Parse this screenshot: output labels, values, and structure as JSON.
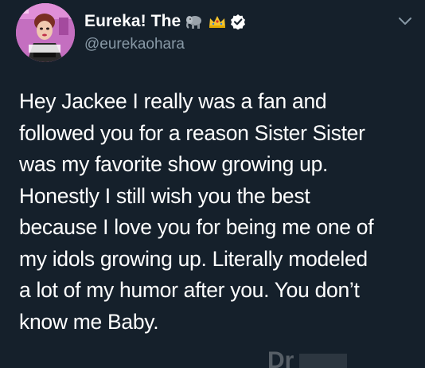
{
  "tweet": {
    "display_name": "Eureka! The",
    "handle": "@eurekaohara",
    "badges": [
      "elephant-icon",
      "crown-icon",
      "verified-badge-icon"
    ],
    "text": "Hey Jackee I really was a fan and\nfollowed  you for a reason Sister Sister\nwas my favorite show growing up.\nHonestly I still wish you the best\nbecause I love you for being me one of\nmy idols growing up. Literally modeled\na lot of my humor after you. You don’t\nknow me Baby."
  },
  "colors": {
    "background": "#15202b",
    "text": "#ffffff",
    "secondary_text": "#8899a6",
    "crown": "#f4c430"
  }
}
